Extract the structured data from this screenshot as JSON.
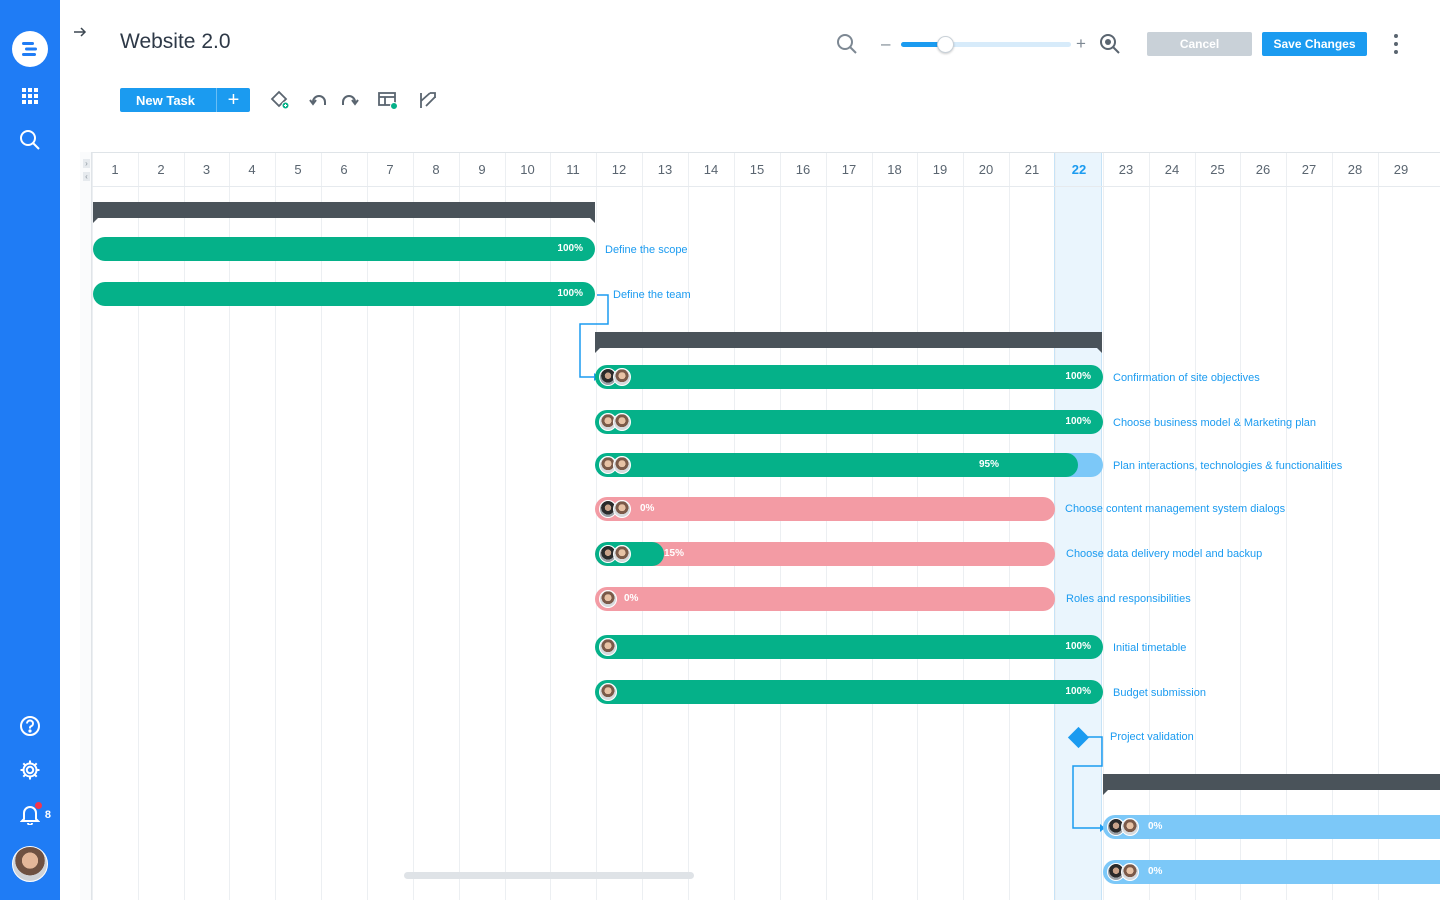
{
  "app": {
    "title": "Website 2.0",
    "notifications_count": "8"
  },
  "header": {
    "cancel_label": "Cancel",
    "save_label": "Save Changes",
    "zoom_minus": "–",
    "zoom_plus": "+",
    "zoom_level": 0.26
  },
  "toolbar": {
    "new_task_label": "New Task",
    "new_task_plus": "+"
  },
  "timeline": {
    "days": [
      "1",
      "2",
      "3",
      "4",
      "5",
      "6",
      "7",
      "8",
      "9",
      "10",
      "11",
      "12",
      "13",
      "14",
      "15",
      "16",
      "17",
      "18",
      "19",
      "20",
      "21",
      "22",
      "23",
      "24",
      "25",
      "26",
      "27",
      "28",
      "29"
    ],
    "today": "22"
  },
  "tasks": {
    "define_scope": {
      "label": "Define the scope",
      "pct": "100%",
      "progress": 1.0
    },
    "define_team": {
      "label": "Define the team",
      "pct": "100%",
      "progress": 1.0
    },
    "site_objectives": {
      "label": "Confirmation of site objectives",
      "pct": "100%",
      "progress": 1.0
    },
    "business_model": {
      "label": "Choose business model & Marketing plan",
      "pct": "100%",
      "progress": 1.0
    },
    "plan_interactions": {
      "label": "Plan interactions, technologies & functionalities",
      "pct": "95%",
      "progress": 0.95
    },
    "cms_dialogs": {
      "label": "Choose content management system dialogs",
      "pct": "0%",
      "progress": 0.0
    },
    "data_delivery": {
      "label": "Choose data delivery model and backup",
      "pct": "15%",
      "progress": 0.15
    },
    "roles": {
      "label": "Roles and responsibilities",
      "pct": "0%",
      "progress": 0.0
    },
    "timetable": {
      "label": "Initial timetable",
      "pct": "100%",
      "progress": 1.0
    },
    "budget": {
      "label": "Budget submission",
      "pct": "100%",
      "progress": 1.0
    },
    "validation": {
      "label": "Project validation"
    },
    "next_task_1": {
      "pct": "0%",
      "progress": 0.0
    },
    "next_task_2": {
      "pct": "0%",
      "progress": 0.0
    }
  },
  "colors": {
    "rail": "#1f7cf5",
    "accent": "#1b9bf0",
    "done": "#05b189",
    "late": "#f39ba4",
    "planned": "#7cc8f8",
    "summary": "#4a535a"
  },
  "icons": {
    "rail": [
      "logo-icon",
      "apps-grid-icon",
      "search-icon",
      "help-icon",
      "settings-gear-icon",
      "bell-icon"
    ],
    "toolbar": [
      "paint-bucket-icon",
      "undo-icon",
      "redo-icon",
      "add-column-icon",
      "critical-path-icon"
    ],
    "header": [
      "arrow-right-icon",
      "search-icon",
      "zoom-fit-icon",
      "more-vertical-icon"
    ]
  }
}
